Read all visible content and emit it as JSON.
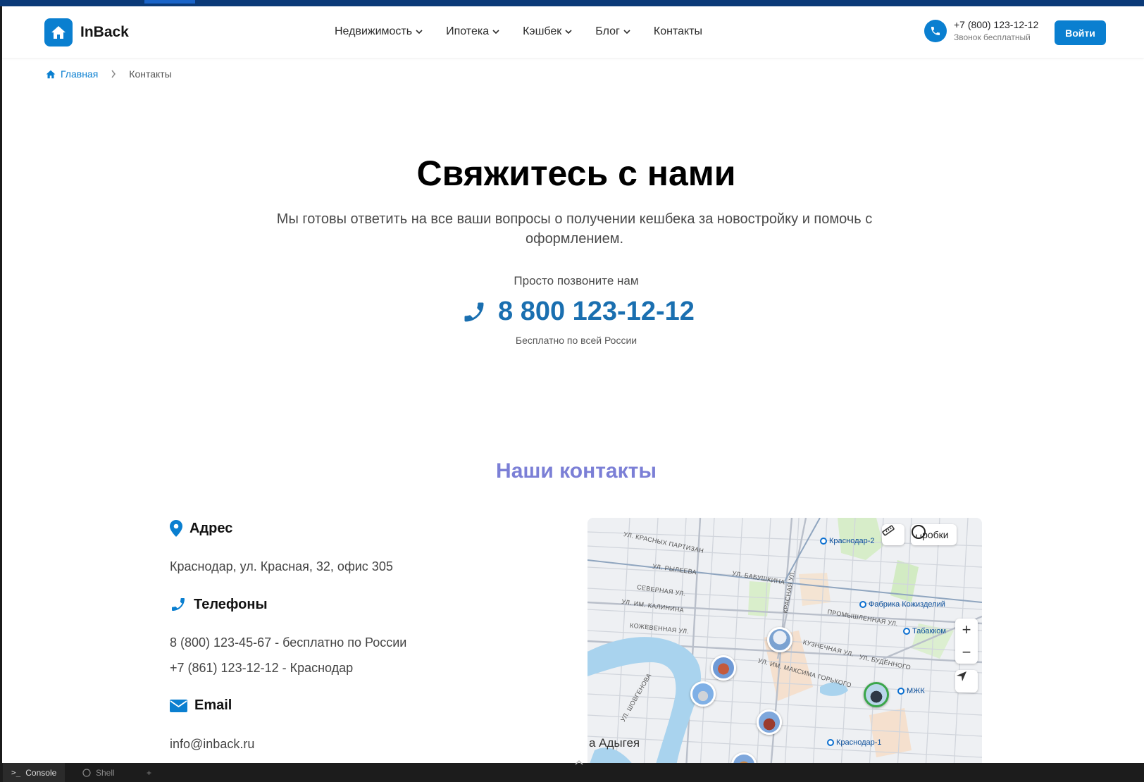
{
  "logo": {
    "name": "InBack"
  },
  "nav": [
    {
      "label": "Недвижимость",
      "dropdown": true
    },
    {
      "label": "Ипотека",
      "dropdown": true
    },
    {
      "label": "Кэшбек",
      "dropdown": true
    },
    {
      "label": "Блог",
      "dropdown": true
    },
    {
      "label": "Контакты",
      "dropdown": false
    }
  ],
  "header": {
    "phone": "+7 (800) 123-12-12",
    "phone_note": "Звонок бесплатный",
    "login": "Войти"
  },
  "breadcrumb": {
    "home": "Главная",
    "current": "Контакты"
  },
  "hero": {
    "title": "Свяжитесь с нами",
    "subtitle": "Мы готовы ответить на все ваши вопросы о получении кешбека за новостройку и помочь с оформлением.",
    "call_label": "Просто позвоните нам",
    "phone": "8 800 123-12-12",
    "phone_note": "Бесплатно по всей России"
  },
  "contacts": {
    "title": "Наши контакты",
    "address_title": "Адрес",
    "address": "Краснодар, ул. Красная, 32, офис 305",
    "phones_title": "Телефоны",
    "phones": [
      "8 (800) 123-45-67 - бесплатно по России",
      "+7 (861) 123-12-12 - Краснодар"
    ],
    "email_title": "Email",
    "email": "info@inback.ru"
  },
  "map": {
    "traffic": "Пробки",
    "zoom_in": "+",
    "zoom_out": "−",
    "places": [
      "Краснодар-2",
      "Фабрика Кожизделий",
      "Табакком",
      "МЖК",
      "Краснодар-1"
    ],
    "streets": [
      "УЛ. КРАСНЫХ ПАРТИЗАН",
      "УЛ. РЫЛЕЕВА",
      "СЕВЕРНАЯ УЛ.",
      "УЛ. ИМ. КАЛИНИНА",
      "КОЖЕВЕННАЯ УЛ.",
      "УЛ. БАБУШКИНА",
      "ПРОМЫШЛЕННАЯ УЛ.",
      "КУЗНЕЧНАЯ УЛ.",
      "УЛ. БУДЁННОГО",
      "УЛ. ИМ. МАКСИМА ГОРЬКОГО",
      "УЛ. ШОВГЕНОВА",
      "КРАСНАЯ УЛ."
    ],
    "region": "а Адыгея"
  },
  "bottombar": {
    "tabs": [
      "Console",
      "Shell"
    ],
    "add": "+"
  },
  "colors": {
    "primary": "#0a7fd0",
    "phone_accent": "#1a6fb0",
    "section_title": "#7b7fd6",
    "top_strip": "#0b3a78"
  }
}
